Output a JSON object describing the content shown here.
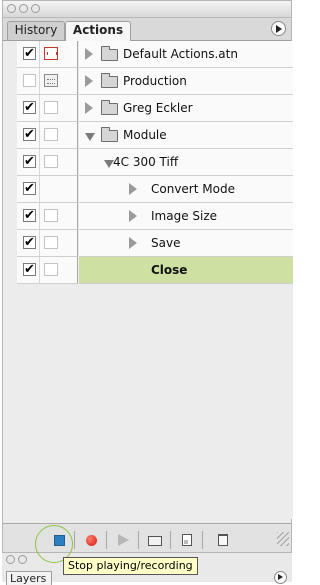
{
  "panel": {
    "tabs": [
      {
        "label": "History",
        "active": false
      },
      {
        "label": "Actions",
        "active": true
      }
    ]
  },
  "actions": [
    {
      "label": "Default Actions.atn",
      "checked": true,
      "dialog": "red",
      "kind": "set",
      "expanded": false
    },
    {
      "label": "Production",
      "checked": false,
      "dialog": "grey",
      "kind": "set",
      "expanded": false
    },
    {
      "label": "Greg Eckler",
      "checked": true,
      "dialog": "empty",
      "kind": "set",
      "expanded": false
    },
    {
      "label": "Module",
      "checked": true,
      "dialog": "empty",
      "kind": "set",
      "expanded": true
    },
    {
      "label": "4C 300 Tiff",
      "checked": true,
      "dialog": "empty",
      "kind": "action",
      "expanded": true
    },
    {
      "label": "Convert Mode",
      "checked": true,
      "dialog": "none",
      "kind": "step",
      "expanded": false
    },
    {
      "label": "Image Size",
      "checked": true,
      "dialog": "empty",
      "kind": "step",
      "expanded": false
    },
    {
      "label": "Save",
      "checked": true,
      "dialog": "empty",
      "kind": "step",
      "expanded": false
    },
    {
      "label": "Close",
      "checked": true,
      "dialog": "empty",
      "kind": "step",
      "selected": true
    }
  ],
  "toolbar": {
    "buttons": [
      "stop-playing-recording",
      "begin-recording",
      "play-selection",
      "create-new-set",
      "create-new-action",
      "delete"
    ]
  },
  "tooltip": {
    "text": "Stop playing/recording"
  },
  "under_panel": {
    "tab_label": "Layers"
  },
  "colors": {
    "selected_row": "#cee1a3",
    "stop_button": "#2a7fc3",
    "record_button": "#d11b0f",
    "dialog_toggle": "#c0392b"
  }
}
